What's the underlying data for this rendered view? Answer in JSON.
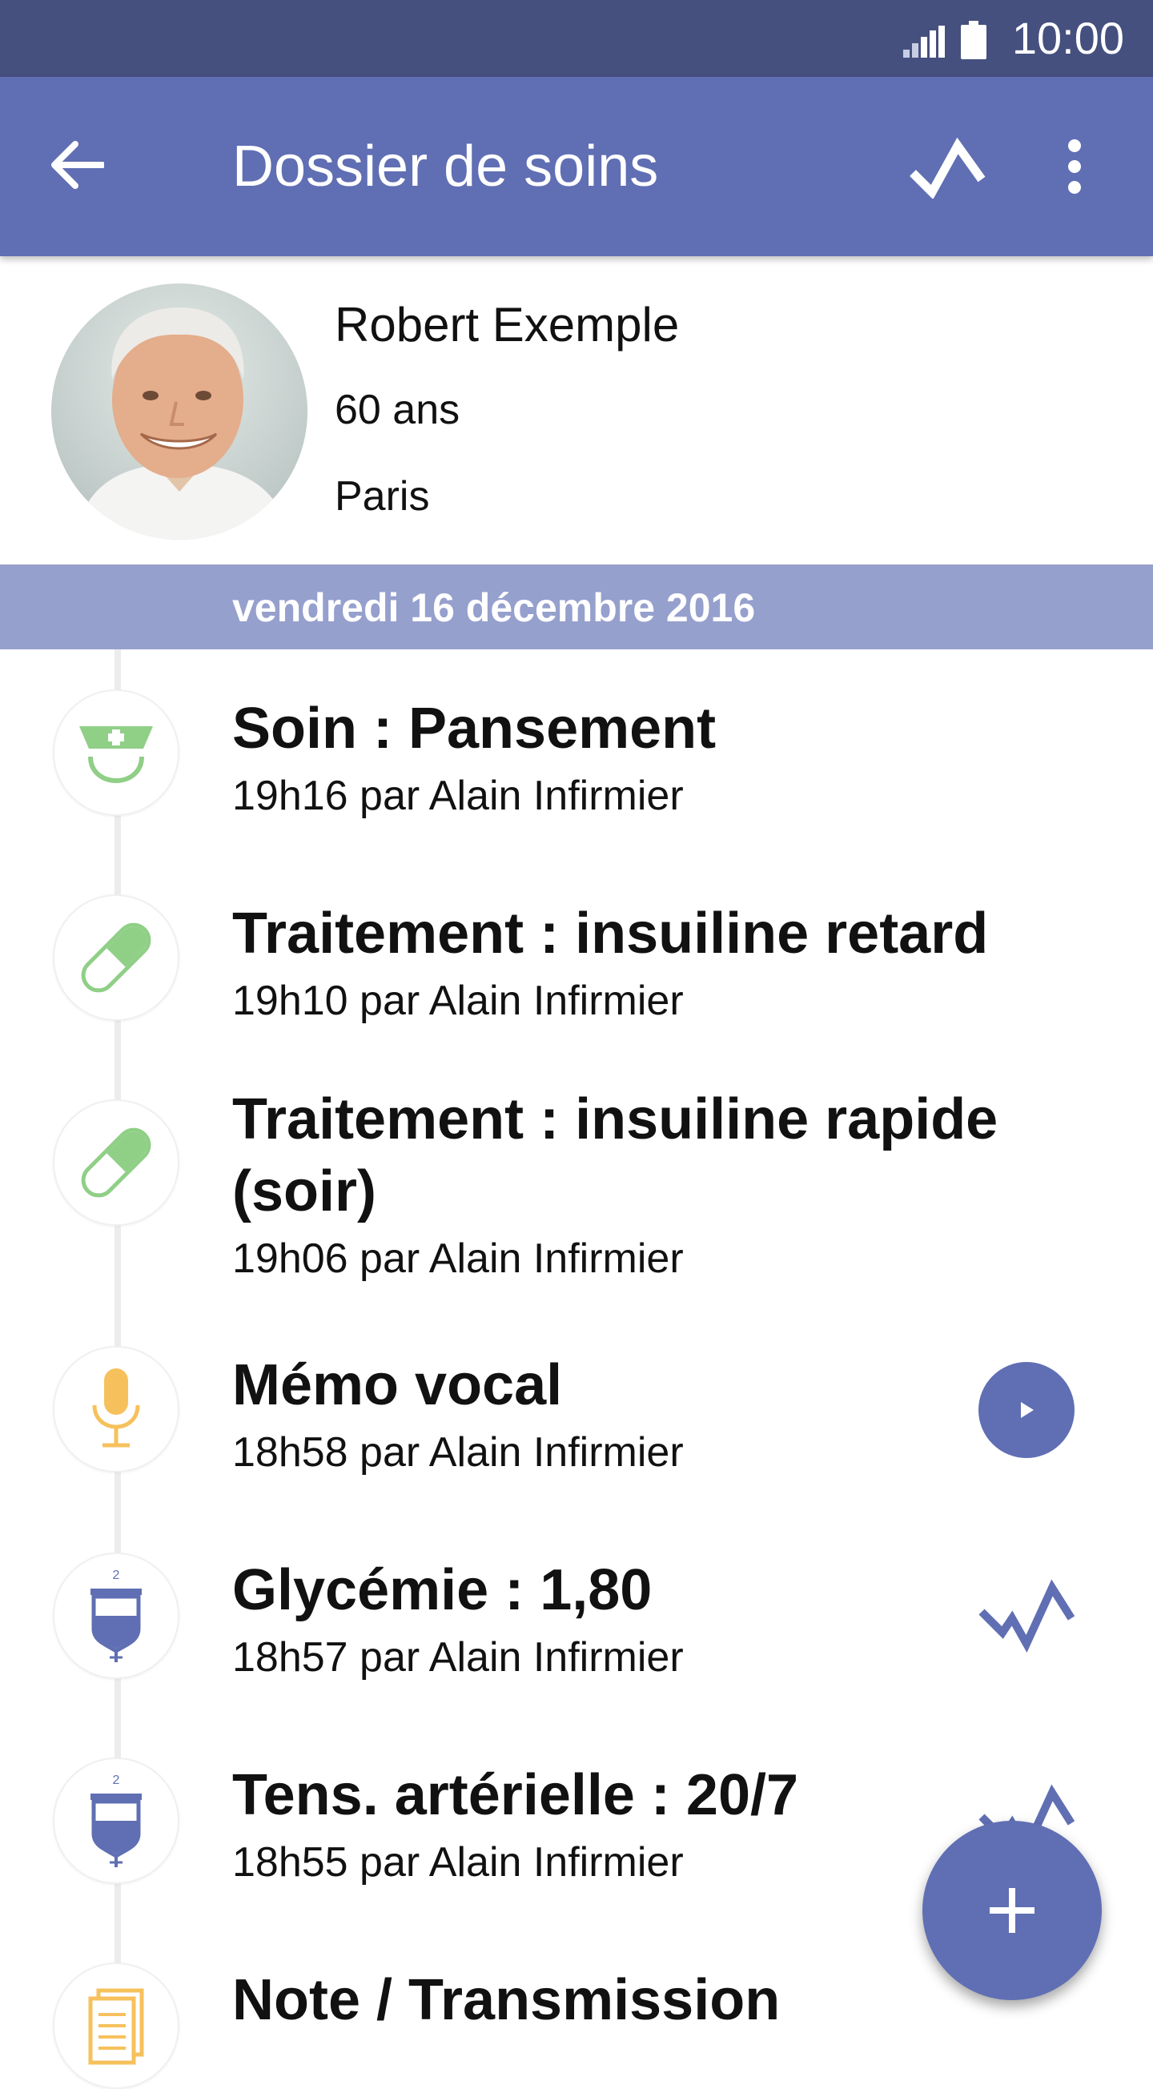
{
  "status_bar": {
    "time": "10:00"
  },
  "app_bar": {
    "title": "Dossier de soins"
  },
  "patient": {
    "name": "Robert Exemple",
    "age": "60 ans",
    "city": "Paris"
  },
  "date_header": "vendredi 16 décembre 2016",
  "entries": [
    {
      "icon": "nurse-icon",
      "title": "Soin : Pansement",
      "subtitle": "19h16 par Alain Infirmier"
    },
    {
      "icon": "pill-icon",
      "title": "Traitement : insuiline retard",
      "subtitle": "19h10 par Alain Infirmier"
    },
    {
      "icon": "pill-icon",
      "title": "Traitement : insuiline rapide (soir)",
      "subtitle": "19h06 par Alain Infirmier"
    },
    {
      "icon": "microphone-icon",
      "title": "Mémo vocal",
      "subtitle": "18h58 par Alain Infirmier",
      "action": "play-icon"
    },
    {
      "icon": "measurement-icon",
      "title": "Glycémie : 1,80",
      "subtitle": "18h57 par Alain Infirmier",
      "action": "trend-icon"
    },
    {
      "icon": "measurement-icon",
      "title": "Tens. artérielle : 20/7",
      "subtitle": "18h55 par Alain Infirmier",
      "action": "trend-icon"
    },
    {
      "icon": "document-icon",
      "title": "Note / Transmission"
    }
  ],
  "colors": {
    "status_bar": "#45507f",
    "app_bar": "#606fb3",
    "date_bar": "#96a0cd",
    "accent": "#606fb3",
    "green_icon": "#8fcf86",
    "yellow_icon": "#f6c15c"
  }
}
